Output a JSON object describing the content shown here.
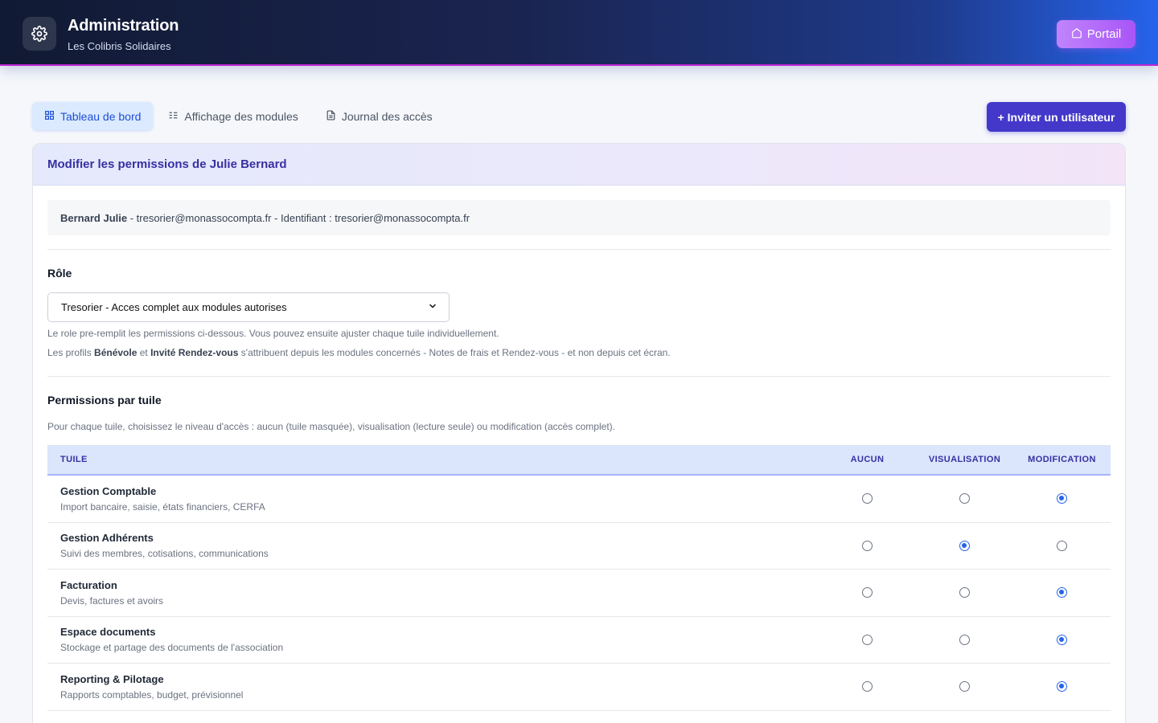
{
  "header": {
    "title": "Administration",
    "subtitle": "Les Colibris Solidaires",
    "portal_label": "Portail",
    "gear_icon": "gear-icon",
    "home_icon": "home-icon"
  },
  "tabs": [
    {
      "label": "Tableau de bord",
      "icon": "grid-icon",
      "active": true
    },
    {
      "label": "Affichage des modules",
      "icon": "list-icon",
      "active": false
    },
    {
      "label": "Journal des accès",
      "icon": "document-icon",
      "active": false
    }
  ],
  "invite_label": "+ Inviter un utilisateur",
  "card": {
    "title": "Modifier les permissions de Julie Bernard",
    "user_name": "Bernard Julie",
    "user_details": " - tresorier@monassocompta.fr - Identifiant : tresorier@monassocompta.fr",
    "role_label": "Rôle",
    "role_value": "Tresorier - Acces complet aux modules autorises",
    "help1": "Le role pre-remplit les permissions ci-dessous. Vous pouvez ensuite ajuster chaque tuile individuellement.",
    "help2_prefix": "Les profils ",
    "help2_benevole": "Bénévole",
    "help2_et": " et ",
    "help2_invite": "Invité Rendez-vous",
    "help2_suffix": " s'attribuent depuis les modules concernés - Notes de frais et Rendez-vous - et non depuis cet écran.",
    "perm_title": "Permissions par tuile",
    "perm_help": "Pour chaque tuile, choisissez le niveau d'accès : aucun (tuile masquée), visualisation (lecture seule) ou modification (accès complet)."
  },
  "table": {
    "headers": [
      "TUILE",
      "AUCUN",
      "VISUALISATION",
      "MODIFICATION"
    ],
    "rows": [
      {
        "title": "Gestion Comptable",
        "desc": "Import bancaire, saisie, états financiers, CERFA",
        "level": "modification"
      },
      {
        "title": "Gestion Adhérents",
        "desc": "Suivi des membres, cotisations, communications",
        "level": "visualisation"
      },
      {
        "title": "Facturation",
        "desc": "Devis, factures et avoirs",
        "level": "modification"
      },
      {
        "title": "Espace documents",
        "desc": "Stockage et partage des documents de l'association",
        "level": "modification"
      },
      {
        "title": "Reporting & Pilotage",
        "desc": "Rapports comptables, budget, prévisionnel",
        "level": "modification"
      }
    ]
  }
}
